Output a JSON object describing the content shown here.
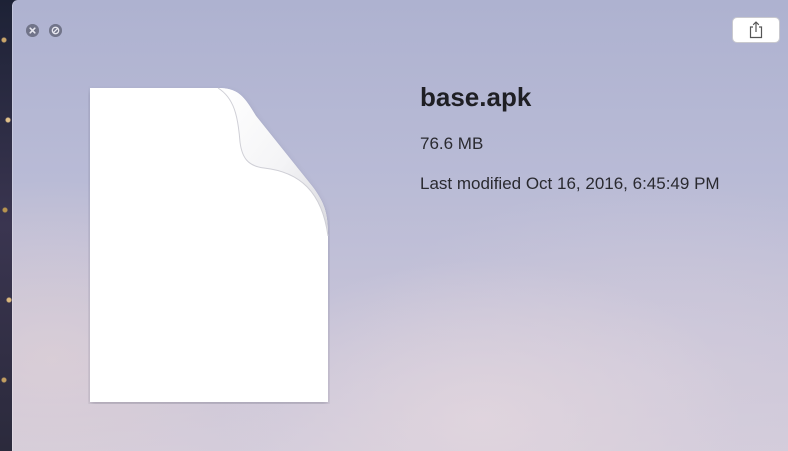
{
  "window": {
    "controls": [
      {
        "name": "close-button",
        "icon": "close-icon"
      },
      {
        "name": "fullscreen-toggle-button",
        "icon": "no-entry-icon"
      }
    ],
    "share_icon": "share-icon"
  },
  "file": {
    "name": "base.apk",
    "size": "76.6 MB",
    "modified": "Last modified Oct 16, 2016, 6:45:49 PM",
    "icon": "document-icon"
  },
  "colors": {
    "panel_top": "#aeb2d0",
    "panel_bottom": "#d3ccdb",
    "title_text": "#1f1f24",
    "control_fill": "#5a5c6e"
  }
}
